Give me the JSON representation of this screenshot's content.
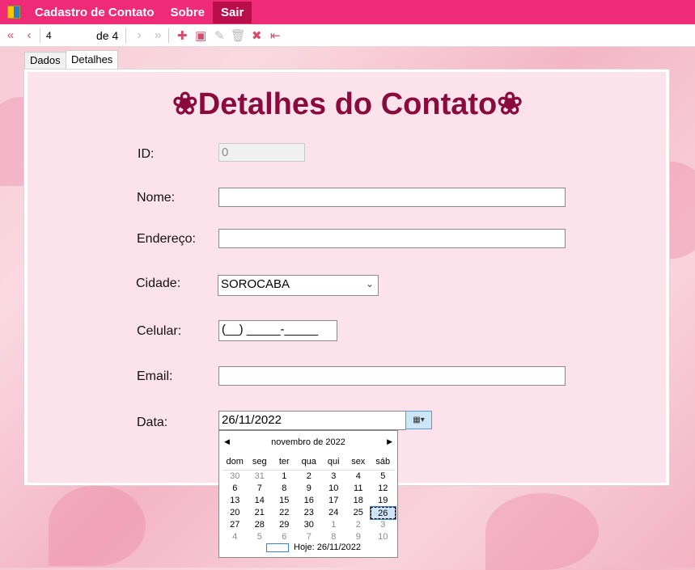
{
  "menu": {
    "items": [
      {
        "label": "Cadastro de Contato"
      },
      {
        "label": "Sobre"
      },
      {
        "label": "Sair"
      }
    ]
  },
  "toolbar": {
    "position": "4",
    "count": "de 4"
  },
  "tabs": [
    {
      "label": "Dados"
    },
    {
      "label": "Detalhes"
    }
  ],
  "form": {
    "title": "❀Detalhes do Contato❀",
    "id_label": "ID:",
    "id_value": "0",
    "nome_label": "Nome:",
    "nome_value": "",
    "endereco_label": "Endereço:",
    "endereco_value": "",
    "cidade_label": "Cidade:",
    "cidade_value": "SOROCABA",
    "celular_label": "Celular:",
    "celular_value": "(__) _____-_____",
    "email_label": "Email:",
    "email_value": "",
    "data_label": "Data:",
    "data_value": "26/11/2022"
  },
  "calendar": {
    "month_title": "novembro de 2022",
    "weekdays": [
      "dom",
      "seg",
      "ter",
      "qua",
      "qui",
      "sex",
      "sáb"
    ],
    "weeks": [
      [
        "30",
        "31",
        "1",
        "2",
        "3",
        "4",
        "5"
      ],
      [
        "6",
        "7",
        "8",
        "9",
        "10",
        "11",
        "12"
      ],
      [
        "13",
        "14",
        "15",
        "16",
        "17",
        "18",
        "19"
      ],
      [
        "20",
        "21",
        "22",
        "23",
        "24",
        "25",
        "26"
      ],
      [
        "27",
        "28",
        "29",
        "30",
        "1",
        "2",
        "3"
      ],
      [
        "4",
        "5",
        "6",
        "7",
        "8",
        "9",
        "10"
      ]
    ],
    "selected": "26",
    "today_label": "Hoje: 26/11/2022"
  },
  "colors": {
    "menu_bg": "#ef2a77",
    "menu_active": "#b90e4a",
    "title": "#8a0a3e",
    "panel_bg": "#fce2ea"
  }
}
